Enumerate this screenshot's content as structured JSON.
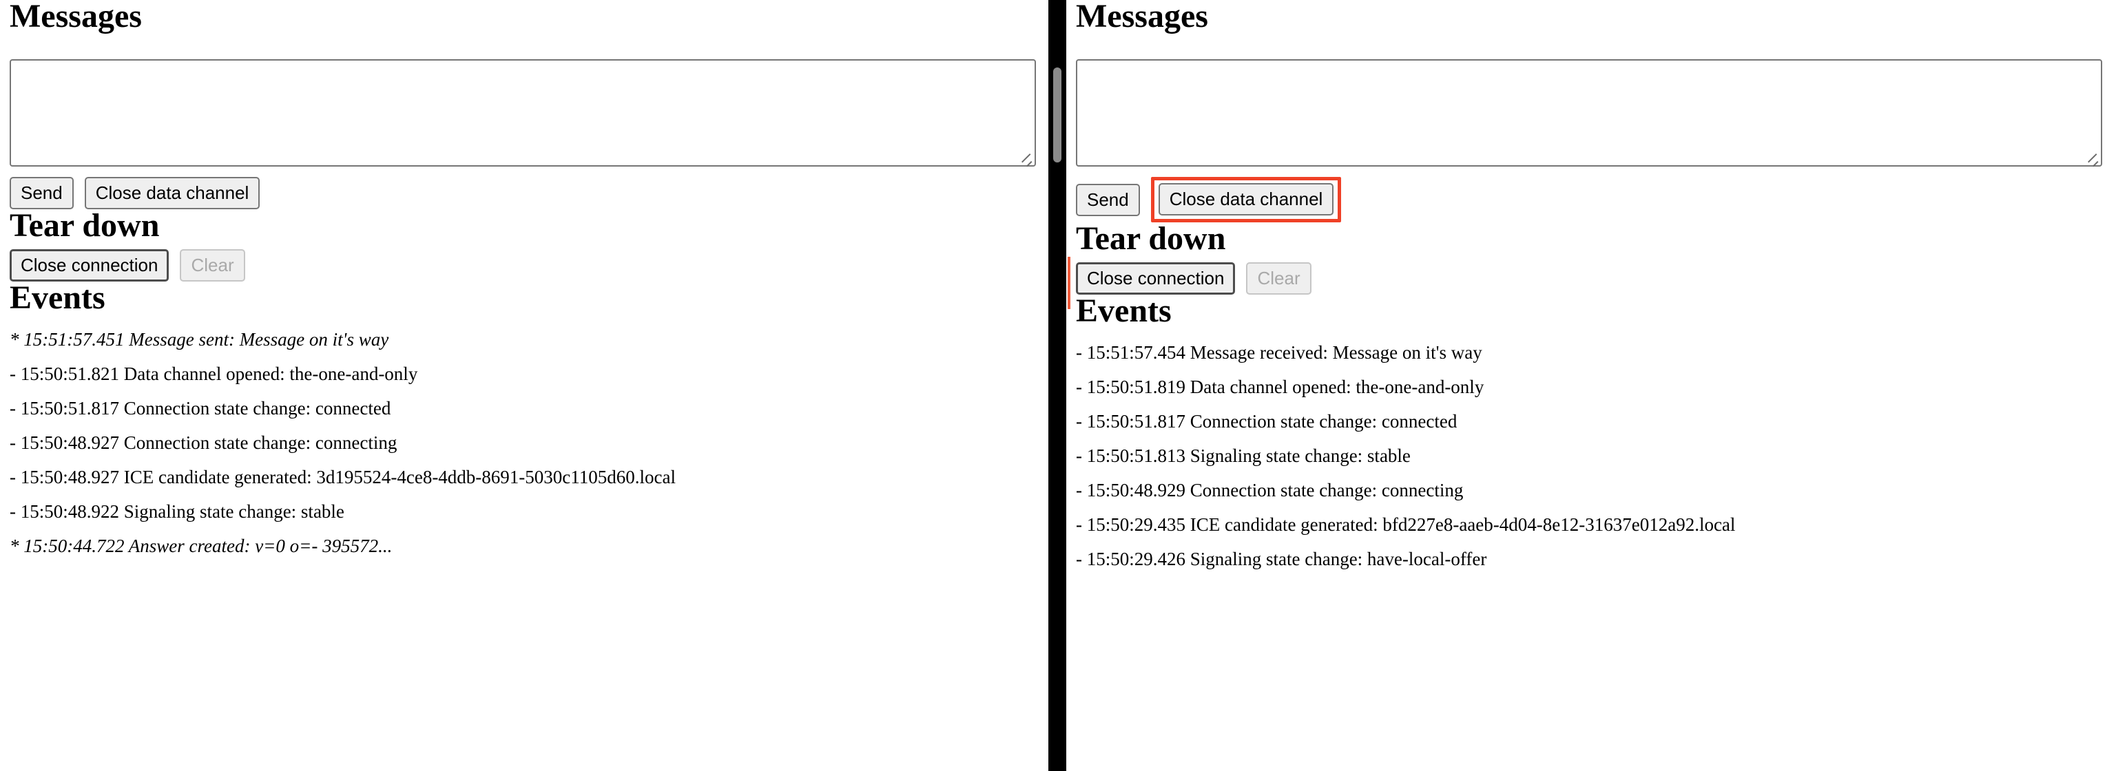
{
  "colors": {
    "highlight_red": "#ef4127",
    "marker_orange": "#ef5a3a",
    "divider_black": "#000000",
    "scrollbar_thumb": "#8b8b8b"
  },
  "left_panel": {
    "messages_heading": "Messages",
    "message_input": {
      "value": "",
      "placeholder": ""
    },
    "send_label": "Send",
    "close_data_channel_label": "Close data channel",
    "teardown_heading": "Tear down",
    "close_connection_label": "Close connection",
    "clear_label": "Clear",
    "events_heading": "Events",
    "events": [
      {
        "prefix": "*",
        "text": "15:51:57.451 Message sent: Message on it's way",
        "italic": true
      },
      {
        "prefix": "-",
        "text": "15:50:51.821 Data channel opened: the-one-and-only",
        "italic": false
      },
      {
        "prefix": "-",
        "text": "15:50:51.817 Connection state change: connected",
        "italic": false
      },
      {
        "prefix": "-",
        "text": "15:50:48.927 Connection state change: connecting",
        "italic": false
      },
      {
        "prefix": "-",
        "text": "15:50:48.927 ICE candidate generated: 3d195524-4ce8-4ddb-8691-5030c1105d60.local",
        "italic": false
      },
      {
        "prefix": "-",
        "text": "15:50:48.922 Signaling state change: stable",
        "italic": false
      },
      {
        "prefix": "*",
        "text": "15:50:44.722 Answer created: v=0 o=- 395572...",
        "italic": true
      }
    ]
  },
  "right_panel": {
    "messages_heading": "Messages",
    "message_input": {
      "value": "",
      "placeholder": ""
    },
    "send_label": "Send",
    "close_data_channel_label": "Close data channel",
    "teardown_heading": "Tear down",
    "close_connection_label": "Close connection",
    "clear_label": "Clear",
    "events_heading": "Events",
    "events": [
      {
        "prefix": "-",
        "text": "15:51:57.454 Message received: Message on it's way",
        "italic": false
      },
      {
        "prefix": "-",
        "text": "15:50:51.819 Data channel opened: the-one-and-only",
        "italic": false
      },
      {
        "prefix": "-",
        "text": "15:50:51.817 Connection state change: connected",
        "italic": false
      },
      {
        "prefix": "-",
        "text": "15:50:51.813 Signaling state change: stable",
        "italic": false
      },
      {
        "prefix": "-",
        "text": "15:50:48.929 Connection state change: connecting",
        "italic": false
      },
      {
        "prefix": "-",
        "text": "15:50:29.435 ICE candidate generated: bfd227e8-aaeb-4d04-8e12-31637e012a92.local",
        "italic": false
      },
      {
        "prefix": "-",
        "text": "15:50:29.426 Signaling state change: have-local-offer",
        "italic": false
      }
    ]
  }
}
